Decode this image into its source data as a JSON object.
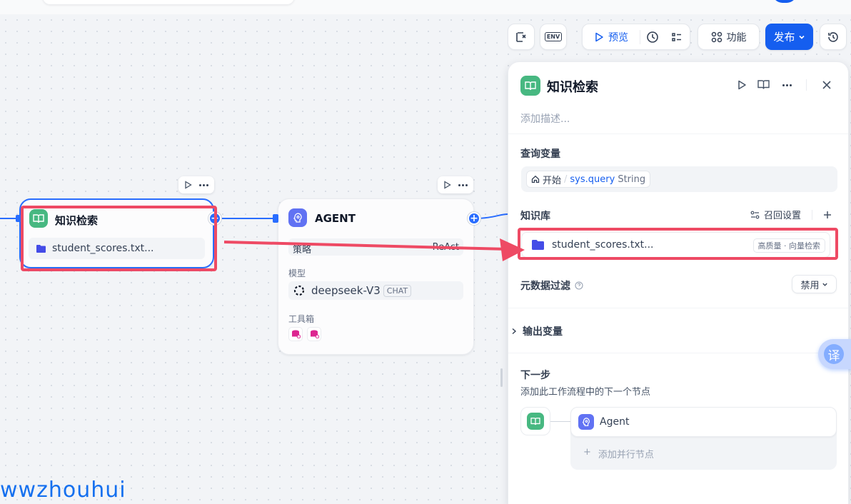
{
  "toolbar": {
    "preview_label": "预览",
    "features_label": "功能",
    "publish_label": "发布",
    "env_label": "ENV"
  },
  "nodes": {
    "knowledge": {
      "title": "知识检索",
      "dataset": "student_scores.txt..."
    },
    "agent": {
      "title": "AGENT",
      "strategy_label": "策略",
      "strategy_value": "ReAct",
      "model_label": "模型",
      "model_name": "deepseek-V3",
      "model_tag": "CHAT",
      "toolbox_label": "工具箱"
    }
  },
  "panel": {
    "title": "知识检索",
    "description_placeholder": "添加描述...",
    "query_section": "查询变量",
    "query_var": {
      "source": "开始",
      "separator": "/",
      "name": "sys.query",
      "type": "String"
    },
    "kb_section": "知识库",
    "recall_settings": "召回设置",
    "kb_item": {
      "name": "student_scores.txt...",
      "tag": "高质量 · 向量检索"
    },
    "metadata_filter": "元数据过滤",
    "metadata_filter_value": "禁用",
    "output_vars": "输出变量",
    "next_step": "下一步",
    "next_step_desc": "添加此工作流程中的下一个节点",
    "next_node": "Agent",
    "add_parallel": "添加并行节点"
  },
  "translate_btn": "译",
  "watermark": "wwzhouhui",
  "colors": {
    "primary": "#155eef",
    "knowledge_icon": "#47b881",
    "agent_icon": "#6172f3",
    "highlight": "#ee4a64"
  }
}
